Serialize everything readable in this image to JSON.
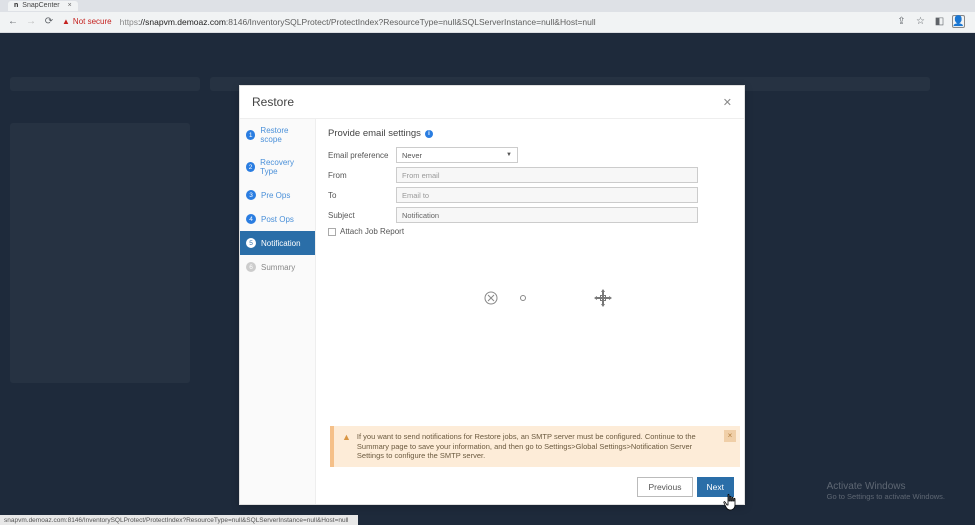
{
  "browser": {
    "tab_title": "SnapCenter",
    "not_secure_label": "Not secure",
    "url_prefix": "https",
    "url_host": "://snapvm.demoaz.com",
    "url_rest": ":8146/InventorySQLProtect/ProtectIndex?ResourceType=null&SQLServerInstance=null&Host=null"
  },
  "modal": {
    "title": "Restore",
    "steps": [
      {
        "num": "1",
        "label": "Restore scope"
      },
      {
        "num": "2",
        "label": "Recovery Type"
      },
      {
        "num": "3",
        "label": "Pre Ops"
      },
      {
        "num": "4",
        "label": "Post Ops"
      },
      {
        "num": "5",
        "label": "Notification"
      },
      {
        "num": "6",
        "label": "Summary"
      }
    ],
    "section_title": "Provide email settings",
    "fields": {
      "email_pref_label": "Email preference",
      "email_pref_value": "Never",
      "from_label": "From",
      "from_placeholder": "From email",
      "to_label": "To",
      "to_placeholder": "Email to",
      "subject_label": "Subject",
      "subject_value": "Notification",
      "attach_label": "Attach Job Report"
    },
    "alert_text": "If you want to send notifications for Restore jobs, an SMTP server must be configured. Continue to the Summary page to save your information, and then go to Settings>Global Settings>Notification Server Settings to configure the SMTP server.",
    "btn_prev": "Previous",
    "btn_next": "Next"
  },
  "watermark": {
    "line1": "Activate Windows",
    "line2": "Go to Settings to activate Windows."
  },
  "status_url": "snapvm.demoaz.com:8146/InventorySQLProtect/ProtectIndex?ResourceType=null&SQLServerInstance=null&Host=null"
}
